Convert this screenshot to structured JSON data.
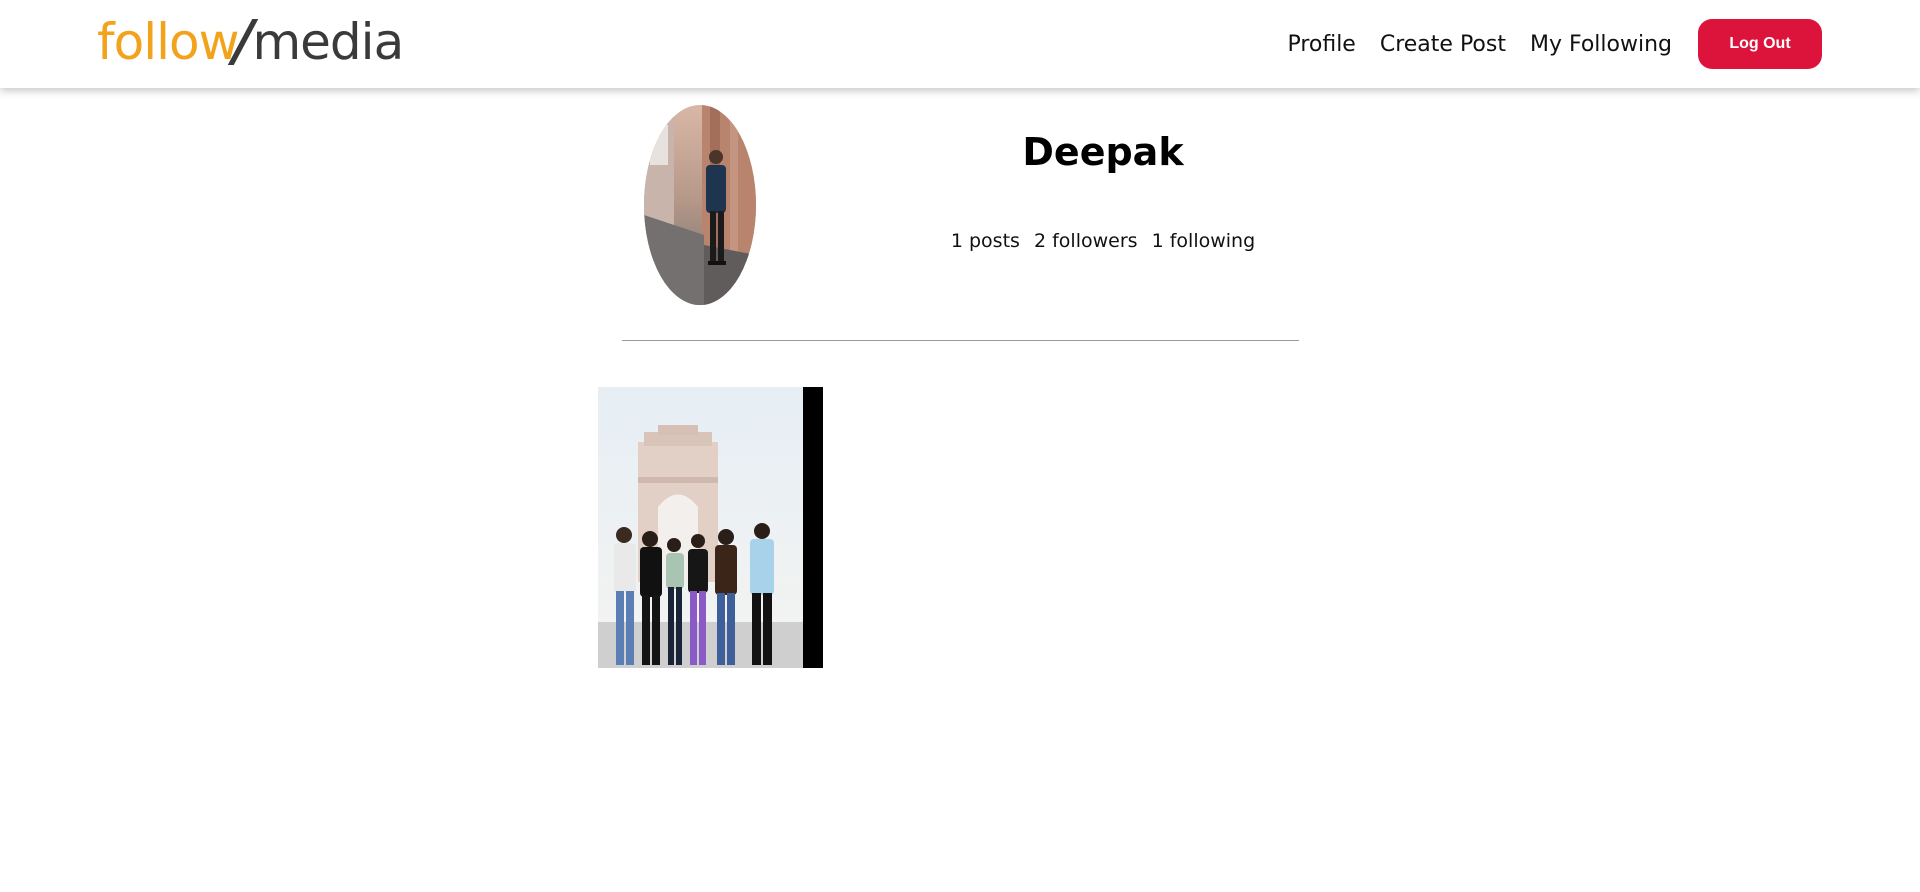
{
  "header": {
    "logo": {
      "part1": "follow",
      "part2": "media"
    },
    "nav": [
      {
        "label": "Profile"
      },
      {
        "label": "Create Post"
      },
      {
        "label": "My Following"
      }
    ],
    "logout_label": "Log Out"
  },
  "profile": {
    "name": "Deepak",
    "stats": {
      "posts": "1 posts",
      "followers": "2 followers",
      "following": "1 following"
    }
  },
  "posts_count": 1,
  "colors": {
    "brand_orange": "#f2a21b",
    "brand_dark": "#3a3a3a",
    "logout_red": "#dc143c",
    "divider": "#9a9a9a"
  }
}
